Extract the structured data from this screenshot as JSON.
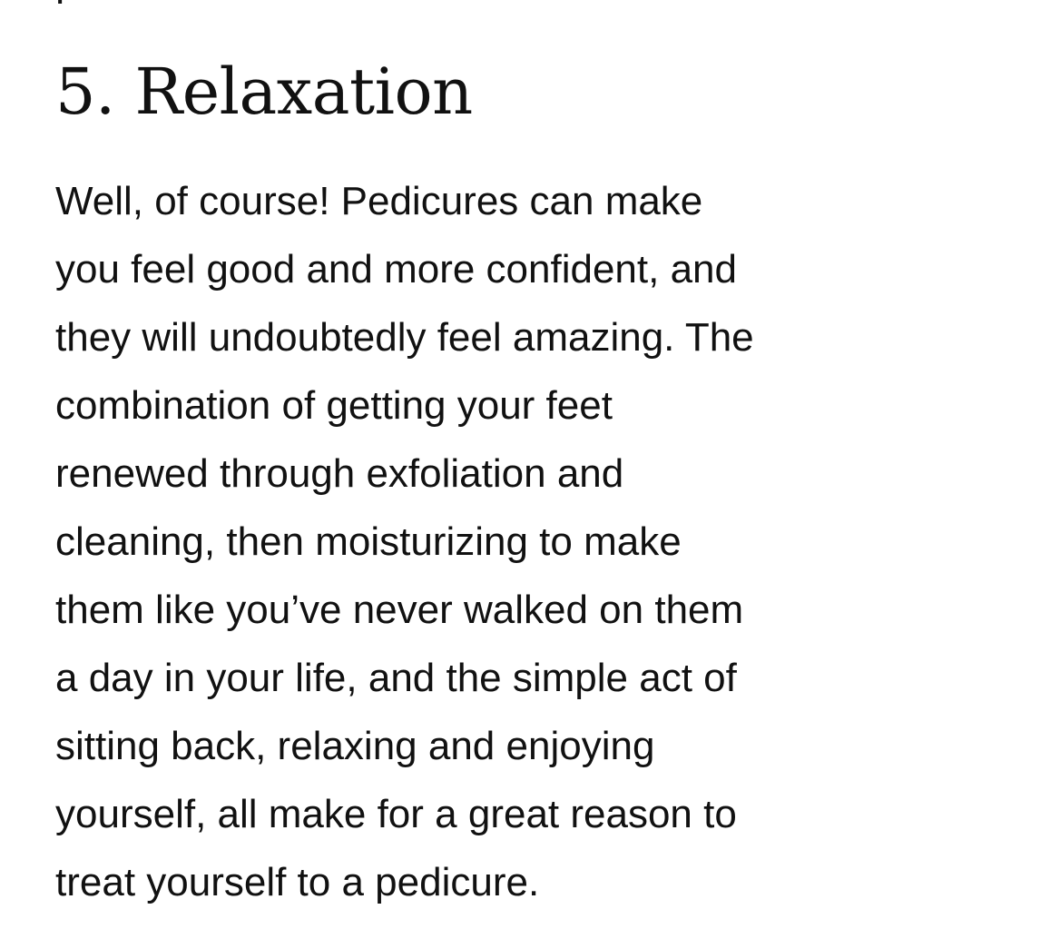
{
  "section": {
    "heading": "5. Relaxation",
    "lines": [
      "Well, of course! Pedicures can make",
      "you feel good and more confident, and",
      "they will undoubtedly feel amazing. The",
      "combination of getting your feet",
      "renewed through exfoliation and",
      "cleaning, then moisturizing to make",
      "them like you’ve never walked on them",
      "a day in your life, and the simple act of",
      "sitting back, relaxing and enjoying",
      "yourself, all make for a great reason to",
      "treat yourself to a pedicure."
    ]
  }
}
